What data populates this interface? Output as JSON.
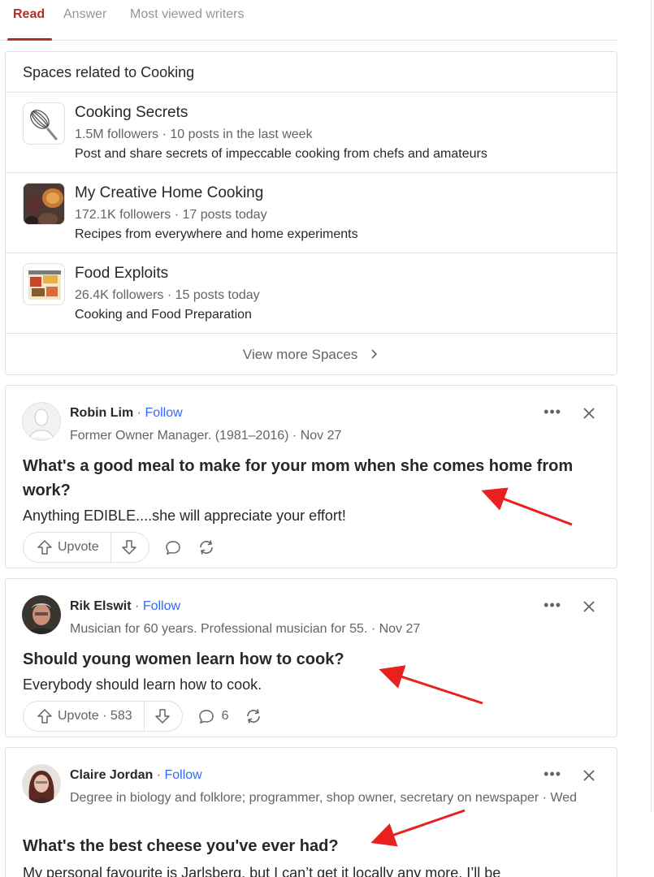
{
  "tabs": [
    {
      "label": "Read"
    },
    {
      "label": "Answer"
    },
    {
      "label": "Most viewed writers"
    }
  ],
  "spaces": {
    "title": "Spaces related to Cooking",
    "items": [
      {
        "name": "Cooking Secrets",
        "meta": "1.5M followers · 10 posts in the last week",
        "desc": "Post and share secrets of impeccable cooking from chefs and amateurs",
        "icon": "whisk-icon"
      },
      {
        "name": "My Creative Home Cooking",
        "meta": "172.1K followers · 17 posts today",
        "desc": "Recipes from everywhere and home experiments",
        "icon": "food-photo-icon"
      },
      {
        "name": "Food Exploits",
        "meta": "26.4K followers · 15 posts today",
        "desc": "Cooking and Food Preparation",
        "icon": "food-platter-icon"
      }
    ],
    "view_more": "View more Spaces"
  },
  "posts": [
    {
      "author": "Robin Lim",
      "follow": "Follow",
      "credential": "Former Owner Manager. (1981–2016) · Nov 27",
      "question": "What's a good meal to make for your mom when she comes home from work?",
      "excerpt": "Anything EDIBLE....she will appreciate your effort!",
      "upvote": "Upvote",
      "comments": ""
    },
    {
      "author": "Rik Elswit",
      "follow": "Follow",
      "credential": "Musician for 60 years. Professional musician for 55. · Nov 27",
      "question": "Should young women learn how to cook?",
      "excerpt": "Everybody should learn how to cook.",
      "upvote": "Upvote · 583",
      "comments": "6"
    },
    {
      "author": "Claire Jordan",
      "follow": "Follow",
      "credential": "Degree in biology and folklore; programmer, shop owner, secretary on newspaper · Wed",
      "question": "What's the best cheese you've ever had?",
      "excerpt": "My personal favourite is Jarlsberg, but I can’t get it locally any more. I’ll be"
    }
  ],
  "colors": {
    "accent": "#b92b27",
    "link": "#2e69ff",
    "annotation_arrow": "#e8201f"
  }
}
